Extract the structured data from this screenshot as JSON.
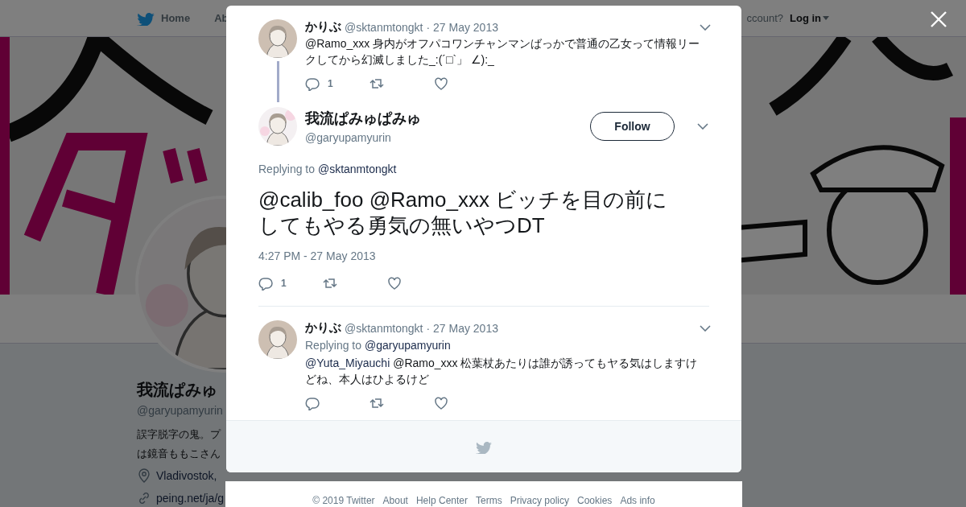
{
  "header": {
    "nav": [
      "Home",
      "Ab"
    ],
    "login_prompt": "ccount?",
    "login": "Log in"
  },
  "profile": {
    "name": "我流ぱみゅ",
    "handle": "@garyupamyurin",
    "bio": [
      "誤字脱字の鬼。プ",
      "は鏡音ももこさん"
    ],
    "location": "Vladivostok,",
    "link": "peing.net/ja/g"
  },
  "tweets": [
    {
      "kind": "ancestor",
      "name": "かりぶ",
      "handle": "@sktanmtongkt",
      "date": "· 27 May 2013",
      "text": "@Ramo_xxx 身内がオフパコワンチャンマンばっかで普通の乙女って情報リークしてから幻滅しました_:(´□`」 ∠):_",
      "reply_count": "1"
    },
    {
      "kind": "focus",
      "name": "我流ぱみゅぱみゅ",
      "handle": "@garyupamyurin",
      "follow": "Follow",
      "replying_label": "Replying to",
      "replying_to": "@sktanmtongkt",
      "text": "@calib_foo @Ramo_xxx ビッチを目の前にしてもやる勇気の無いやつDT",
      "time": "4:27 PM - 27 May 2013",
      "reply_count": "1"
    },
    {
      "kind": "reply",
      "name": "かりぶ",
      "handle": "@sktanmtongkt",
      "date": "· 27 May 2013",
      "replying_label": "Replying to",
      "replying_to": "@garyupamyurin",
      "mention": "@Yuta_Miyauchi",
      "text": "@Ramo_xxx 松葉杖あたりは誰が誘ってもヤる気はしますけどね、本人はひよるけど"
    }
  ],
  "footer": [
    "© 2019 Twitter",
    "About",
    "Help Center",
    "Terms",
    "Privacy policy",
    "Cookies",
    "Ads info"
  ]
}
